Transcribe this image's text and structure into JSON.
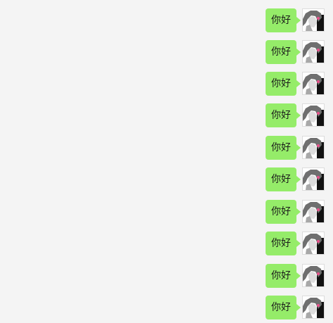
{
  "messages": [
    {
      "text": "你好",
      "sender": "self"
    },
    {
      "text": "你好",
      "sender": "self"
    },
    {
      "text": "你好",
      "sender": "self"
    },
    {
      "text": "你好",
      "sender": "self"
    },
    {
      "text": "你好",
      "sender": "self"
    },
    {
      "text": "你好",
      "sender": "self"
    },
    {
      "text": "你好",
      "sender": "self"
    },
    {
      "text": "你好",
      "sender": "self"
    },
    {
      "text": "你好",
      "sender": "self"
    },
    {
      "text": "你好",
      "sender": "self"
    }
  ],
  "colors": {
    "background": "#f4f4f4",
    "bubble": "#95ec69",
    "text": "#1a1a1a"
  },
  "icons": {
    "avatar": "avatar-image"
  }
}
